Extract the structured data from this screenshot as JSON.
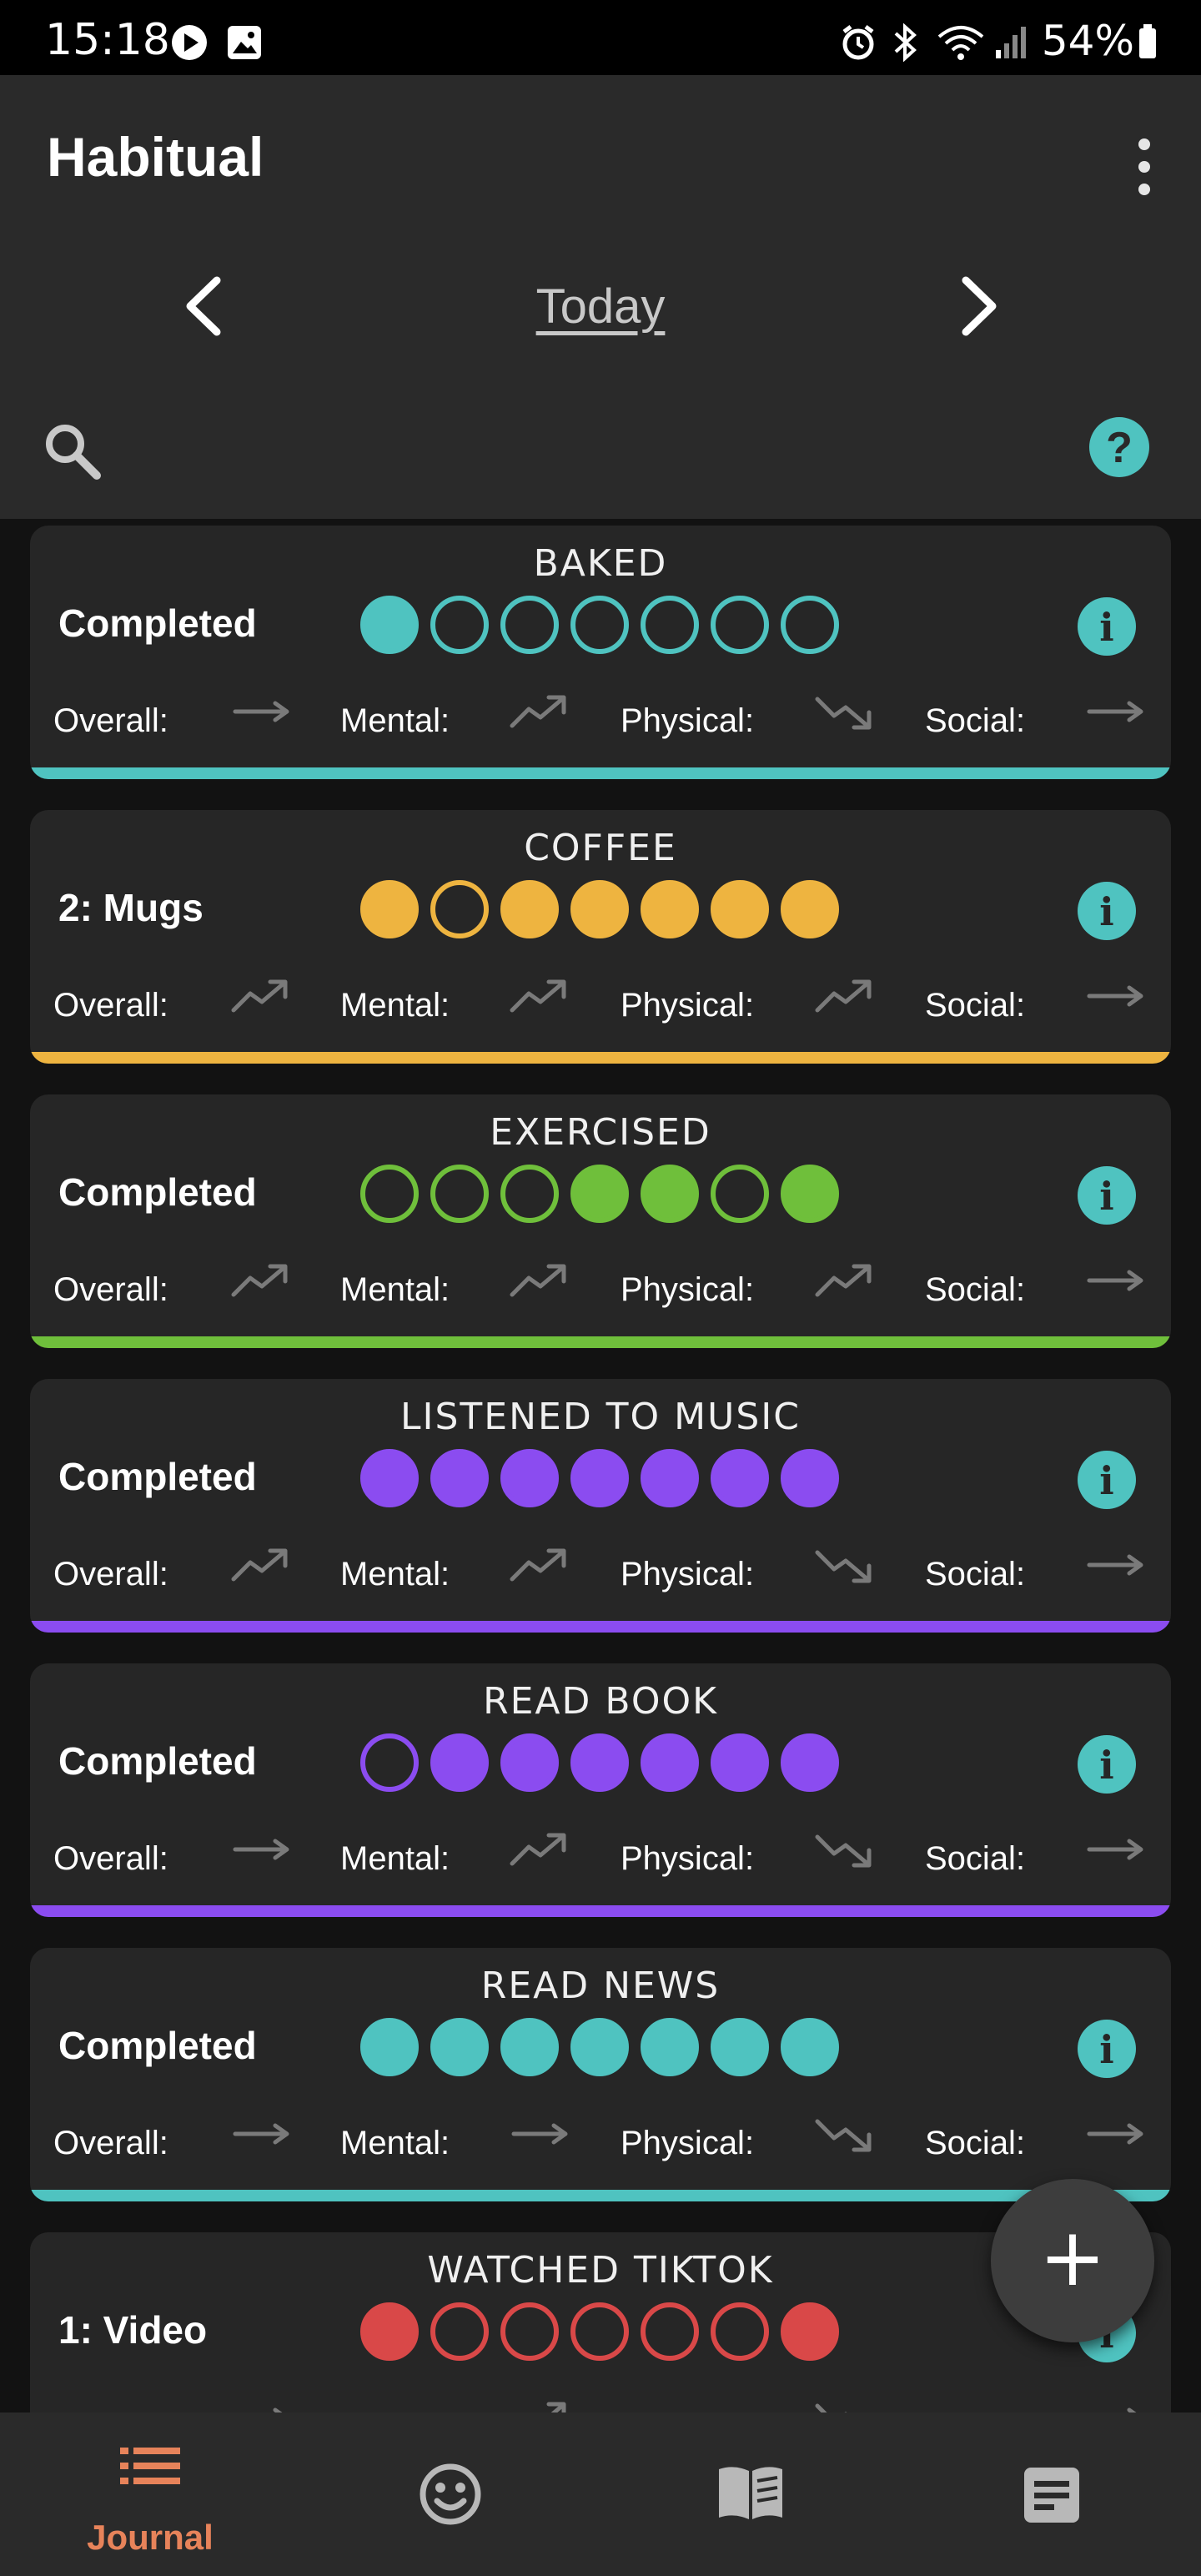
{
  "status_bar": {
    "time": "15:18",
    "battery": "54%"
  },
  "header": {
    "app_title": "Habitual",
    "date_label": "Today"
  },
  "colors": {
    "teal": "#4fc3c0",
    "amber": "#eeb440",
    "green": "#6fbf3b",
    "purple": "#8b4cf0",
    "red": "#d94848",
    "accent_orange": "#e7835a",
    "trend_gray": "#7a7a7a"
  },
  "metric_labels": {
    "overall": "Overall:",
    "mental": "Mental:",
    "physical": "Physical:",
    "social": "Social:"
  },
  "habits": [
    {
      "name": "BAKED",
      "status": "Completed",
      "color": "#4fc3c0",
      "week": [
        true,
        false,
        false,
        false,
        false,
        false,
        false
      ],
      "trends": {
        "overall": "flat",
        "mental": "up",
        "physical": "down",
        "social": "flat"
      }
    },
    {
      "name": "COFFEE",
      "status": "2: Mugs",
      "color": "#eeb440",
      "week": [
        true,
        false,
        true,
        true,
        true,
        true,
        true
      ],
      "trends": {
        "overall": "up",
        "mental": "up",
        "physical": "up",
        "social": "flat"
      }
    },
    {
      "name": "EXERCISED",
      "status": "Completed",
      "color": "#6fbf3b",
      "week": [
        false,
        false,
        false,
        true,
        true,
        false,
        true
      ],
      "trends": {
        "overall": "up",
        "mental": "up",
        "physical": "up",
        "social": "flat"
      }
    },
    {
      "name": "LISTENED TO MUSIC",
      "status": "Completed",
      "color": "#8b4cf0",
      "week": [
        true,
        true,
        true,
        true,
        true,
        true,
        true
      ],
      "trends": {
        "overall": "up",
        "mental": "up",
        "physical": "down",
        "social": "flat"
      }
    },
    {
      "name": "READ BOOK",
      "status": "Completed",
      "color": "#8b4cf0",
      "week": [
        false,
        true,
        true,
        true,
        true,
        true,
        true
      ],
      "trends": {
        "overall": "flat",
        "mental": "up",
        "physical": "down",
        "social": "flat"
      }
    },
    {
      "name": "READ NEWS",
      "status": "Completed",
      "color": "#4fc3c0",
      "week": [
        true,
        true,
        true,
        true,
        true,
        true,
        true
      ],
      "trends": {
        "overall": "flat",
        "mental": "flat",
        "physical": "down",
        "social": "flat"
      }
    },
    {
      "name": "WATCHED TIKTOK",
      "status": "1: Video",
      "color": "#d94848",
      "week": [
        true,
        false,
        false,
        false,
        false,
        false,
        true
      ],
      "trends": {
        "overall": "flat",
        "mental": "up",
        "physical": "down",
        "social": "flat"
      }
    }
  ],
  "bottom_nav": [
    {
      "icon": "journal-list-icon",
      "label": "Journal",
      "active": true
    },
    {
      "icon": "mood-smiley-icon",
      "label": "",
      "active": false
    },
    {
      "icon": "book-icon",
      "label": "",
      "active": false
    },
    {
      "icon": "notes-icon",
      "label": "",
      "active": false
    }
  ]
}
